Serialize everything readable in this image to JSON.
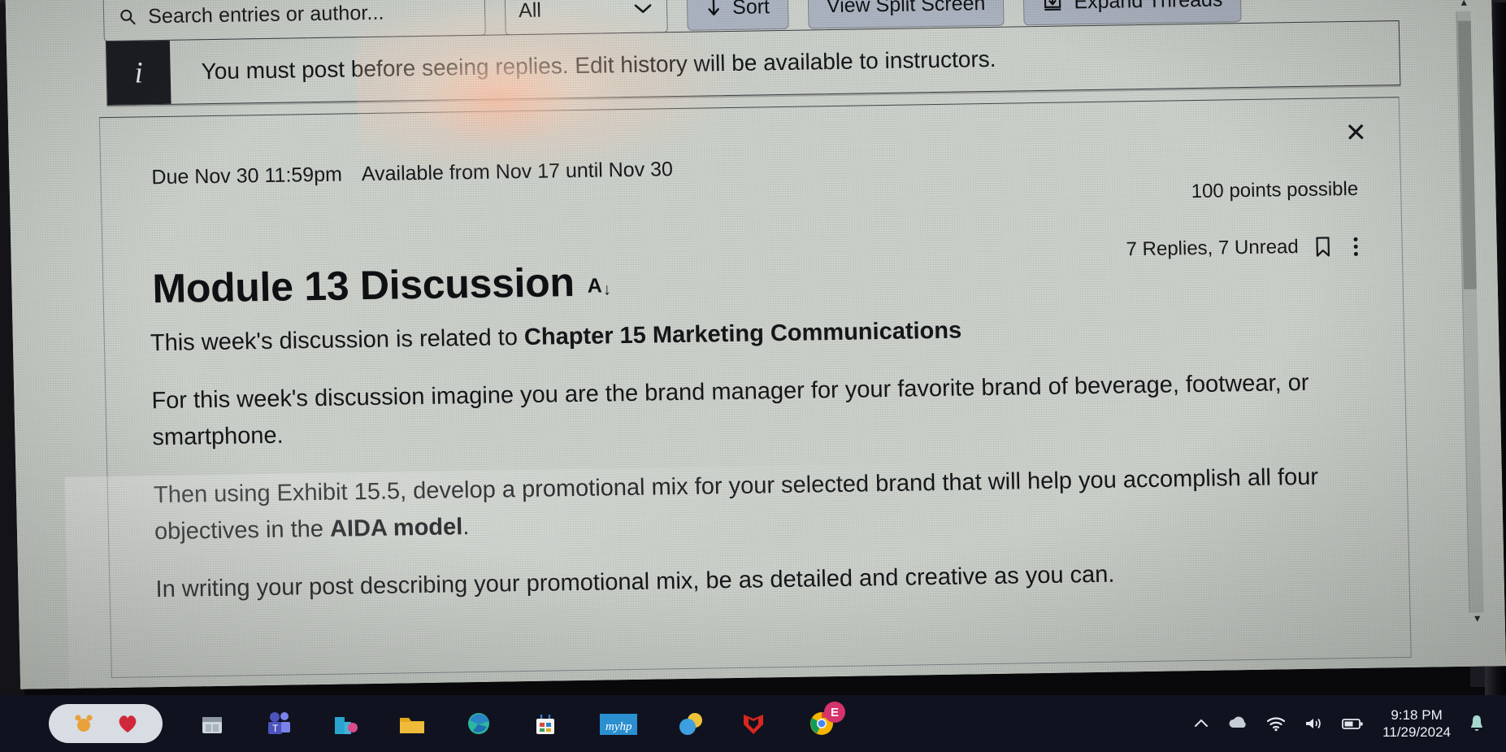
{
  "toolbar": {
    "search_placeholder": "Search entries or author...",
    "search_icon": "search-icon",
    "filter_value": "All",
    "filter_chevron": "chevron-down-icon",
    "sort_label": "Sort",
    "sort_icon": "down-arrow-icon",
    "split_screen_label": "View Split Screen",
    "expand_threads_label": "Expand Threads",
    "expand_icon": "download-tray-icon"
  },
  "alert": {
    "icon": "info-icon",
    "icon_glyph": "i",
    "message": "You must post before seeing replies. Edit history will be available to instructors."
  },
  "discussion": {
    "close_icon": "close-icon",
    "close_glyph": "✕",
    "due": "Due Nov 30 11:59pm",
    "available": "Available from Nov 17 until Nov 30",
    "points": "100 points possible",
    "replies": "7 Replies, 7 Unread",
    "bookmark_icon": "bookmark-icon",
    "menu_icon": "kebab-menu-icon",
    "title": "Module 13 Discussion",
    "title_adornment_letter": "A",
    "title_adornment_arrow": "↓",
    "paragraphs": [
      {
        "parts": [
          {
            "text": "This week's discussion is related to ",
            "bold": false
          },
          {
            "text": "Chapter 15 Marketing Communications",
            "bold": true
          }
        ]
      },
      {
        "parts": [
          {
            "text": "For this week's discussion imagine you are the brand manager for your favorite brand of beverage, footwear, or smartphone.",
            "bold": false
          }
        ]
      },
      {
        "parts": [
          {
            "text": "Then using Exhibit 15.5, develop a promotional mix for your selected brand that will help you accomplish all four objectives in the ",
            "bold": false
          },
          {
            "text": "AIDA model",
            "bold": true
          },
          {
            "text": ".",
            "bold": false
          }
        ]
      },
      {
        "parts": [
          {
            "text": "In writing your post describing your promotional mix, be as detailed and creative as you can.",
            "bold": false
          }
        ]
      }
    ]
  },
  "scrollbar": {
    "up_arrow": "▲",
    "down_arrow": "▼"
  },
  "taskbar": {
    "apps": [
      {
        "name": "paw-app-icon",
        "label": ""
      },
      {
        "name": "file-explorer-icon",
        "label": ""
      },
      {
        "name": "microsoft-teams-icon",
        "label": ""
      },
      {
        "name": "office-app-icon",
        "label": ""
      },
      {
        "name": "folder-icon",
        "label": ""
      },
      {
        "name": "microsoft-edge-icon",
        "label": ""
      },
      {
        "name": "microsoft-store-icon",
        "label": ""
      },
      {
        "name": "my-hp-icon",
        "label": "myhp"
      },
      {
        "name": "weather-icon",
        "label": ""
      },
      {
        "name": "mcafee-icon",
        "label": ""
      },
      {
        "name": "google-chrome-icon",
        "label": "E"
      }
    ],
    "system": {
      "show_hidden_icons": "chevron-up-icon",
      "onedrive_icon": "cloud-icon",
      "network_icon": "wifi-icon",
      "volume_icon": "speaker-icon",
      "battery_icon": "battery-icon",
      "notification_icon": "bell-icon"
    },
    "clock": {
      "time": "9:18 PM",
      "date": "11/29/2024"
    }
  },
  "colors": {
    "screen_bg": "#cdd2cc",
    "button_bg": "#aeb5c2",
    "alert_icon_bg": "#1d1f24",
    "taskbar_bg": "#10131f",
    "text": "#141619"
  }
}
